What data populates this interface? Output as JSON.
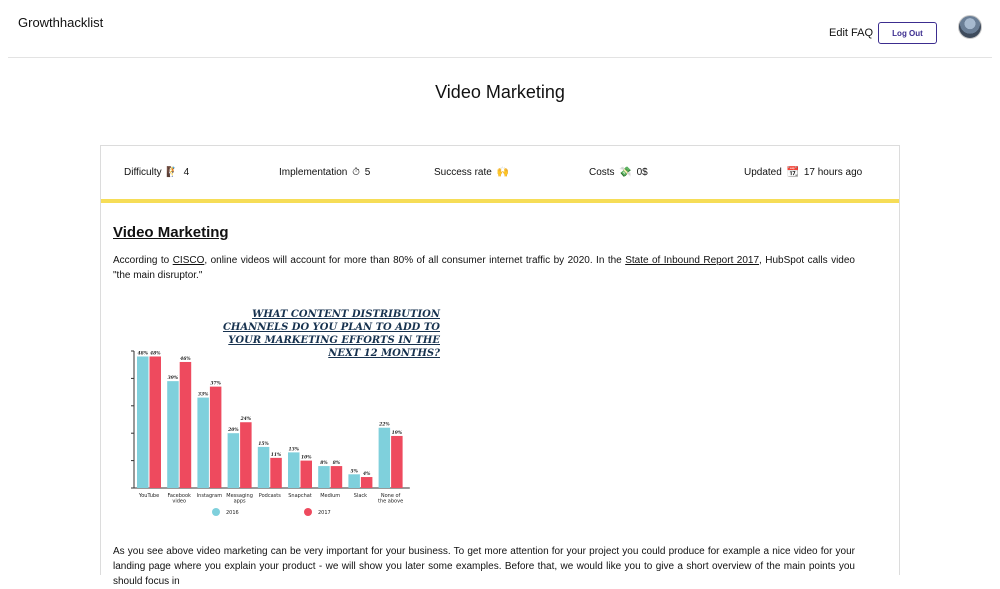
{
  "header": {
    "brand": "Growthhacklist",
    "nav_edit": "Edit",
    "nav_faq": "FAQ",
    "logout_label": "Log Out",
    "logout_color": "#3c2d8f"
  },
  "page": {
    "title": "Video Marketing"
  },
  "stats": {
    "difficulty_label": "Difficulty",
    "difficulty_icon": "🧗",
    "difficulty_value": "4",
    "implementation_label": "Implementation",
    "implementation_icon": "⏱",
    "implementation_value": "5",
    "success_label": "Success rate",
    "success_icon": "🙌",
    "costs_label": "Costs",
    "costs_icon": "💸",
    "costs_value": "0$",
    "updated_label": "Updated",
    "updated_icon": "📆",
    "updated_value": "17 hours ago",
    "accent_color": "#f6dd57"
  },
  "article": {
    "heading": "Video Marketing",
    "p1_before": "According to ",
    "p1_link1": "CISCO",
    "p1_middle": ", online videos will account for more than 80% of all consumer internet traffic by 2020. In the ",
    "p1_link2": "State of Inbound Report 2017",
    "p1_after": ", HubSpot calls video \"the main disruptor.\"",
    "p2": "As you see above video marketing can be very important for your business. To get more attention for your project you could produce for example a nice video for your landing page where you explain your product - we will show you later some examples. Before that, we would like you to give a short overview of the main points you should focus in"
  },
  "chart_data": {
    "type": "bar",
    "title": "WHAT CONTENT DISTRIBUTION CHANNELS DO YOU PLAN TO ADD TO YOUR MARKETING EFFORTS IN THE NEXT 12 MONTHS?",
    "categories": [
      "YouTube",
      "Facebook video",
      "Instagram",
      "Messaging apps",
      "Podcasts",
      "Snapchat",
      "Medium",
      "Slack",
      "None of the above"
    ],
    "series": [
      {
        "name": "2016",
        "color": "#7fd0dc",
        "values": [
          48,
          39,
          33,
          20,
          15,
          13,
          8,
          5,
          22
        ]
      },
      {
        "name": "2017",
        "color": "#ee4a5e",
        "values": [
          48,
          46,
          37,
          24,
          11,
          10,
          8,
          4,
          19
        ]
      }
    ],
    "ylim": [
      0,
      50
    ],
    "legend": "bottom"
  }
}
